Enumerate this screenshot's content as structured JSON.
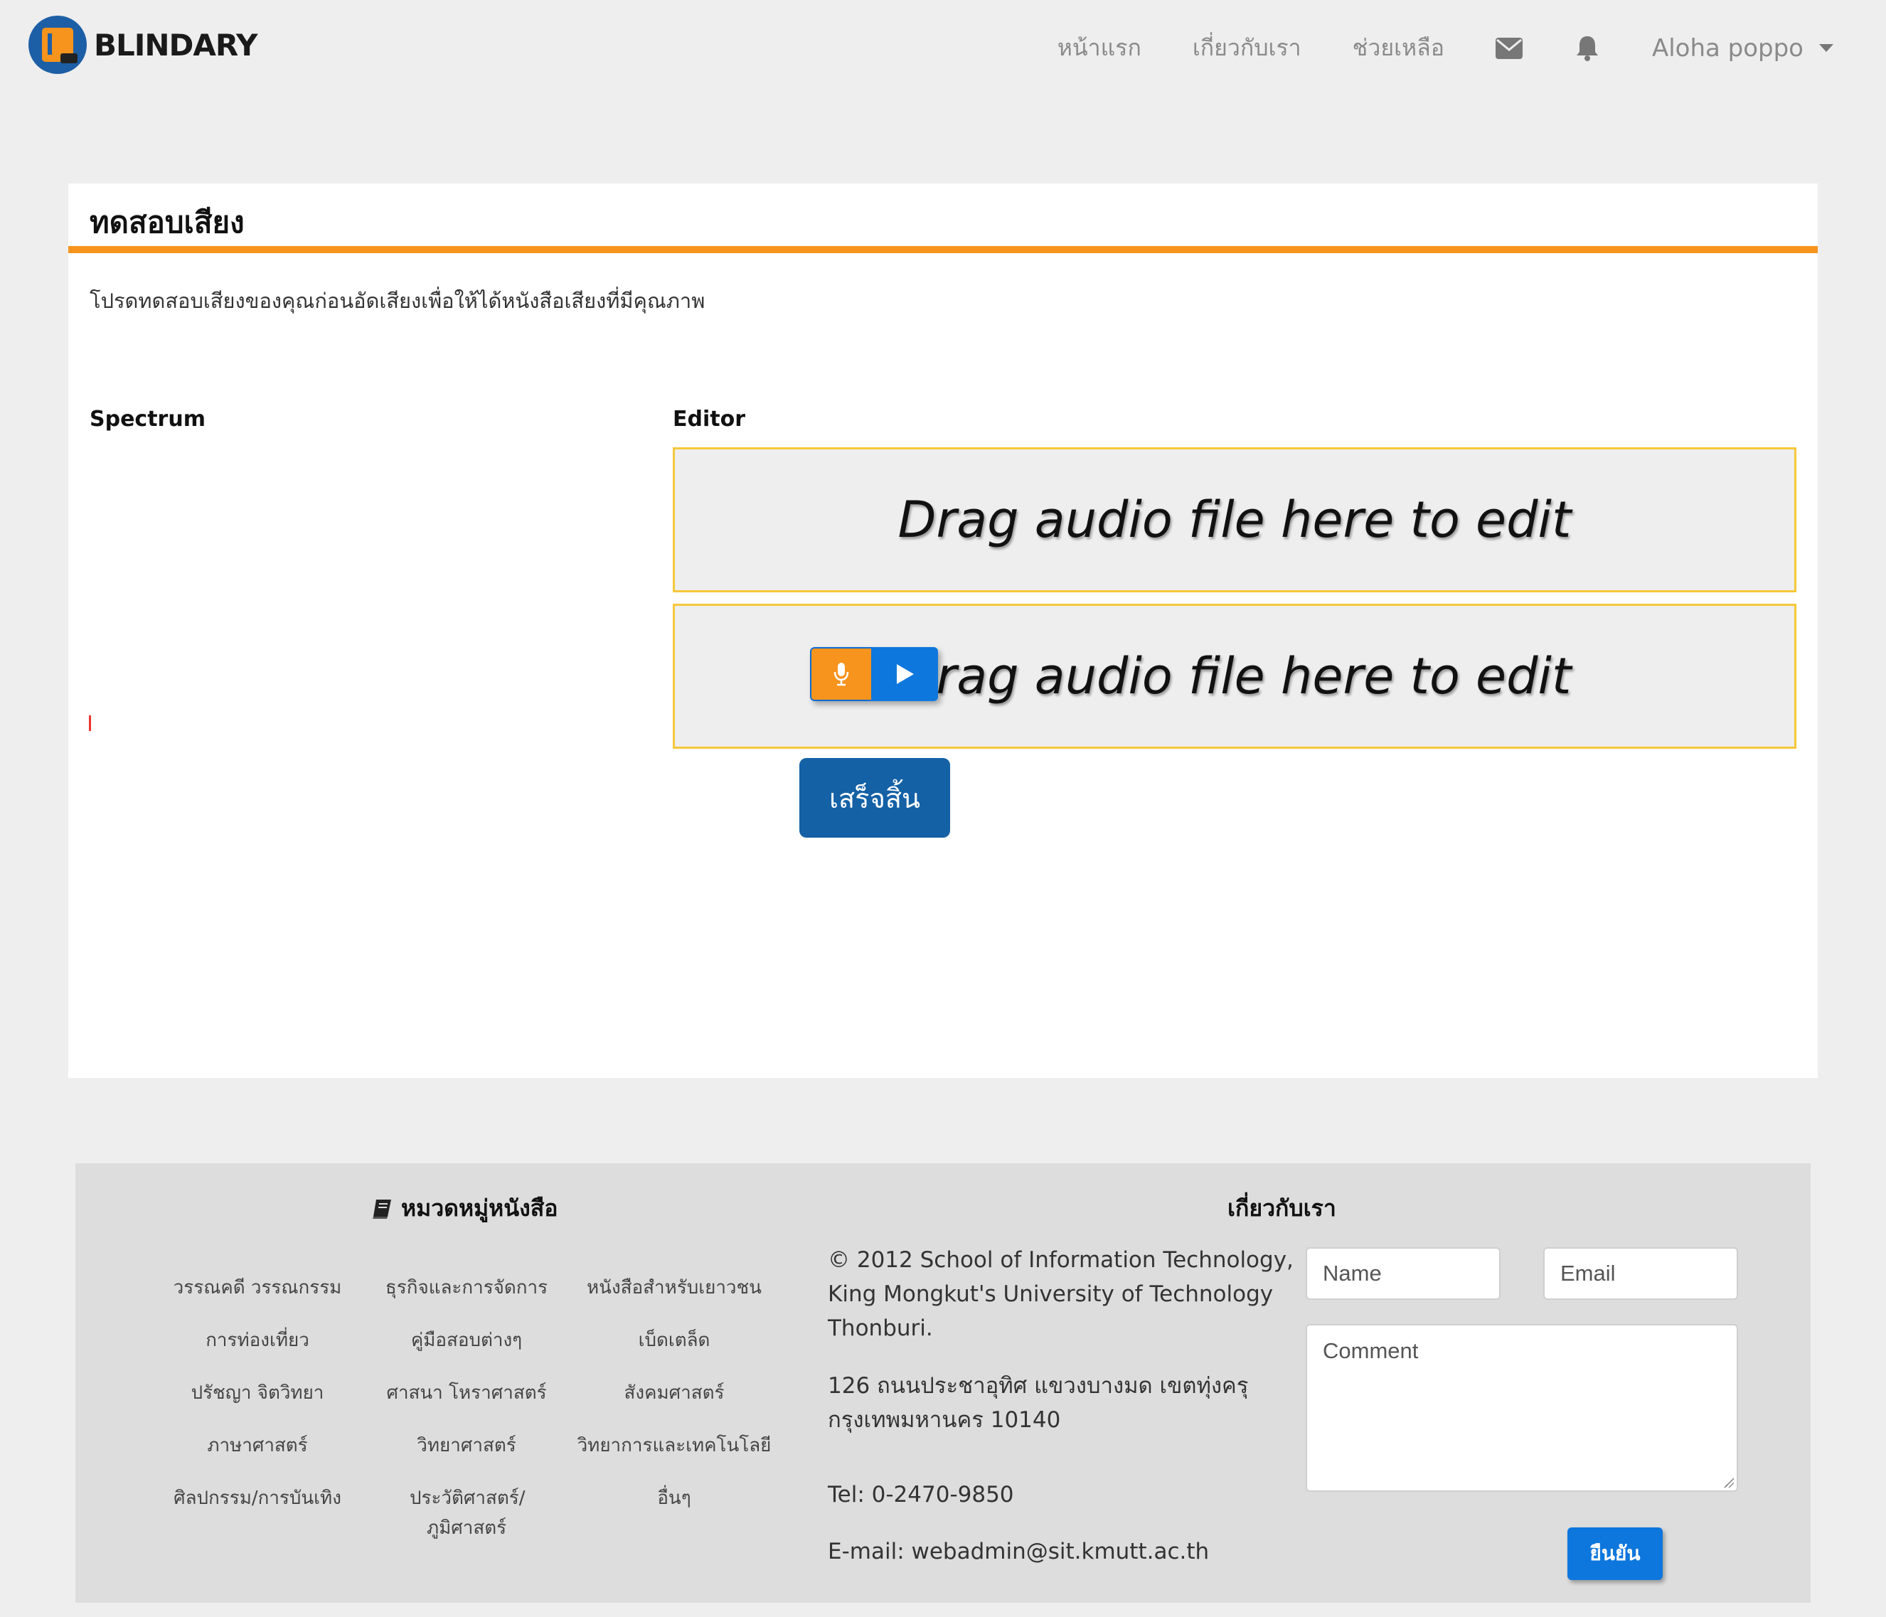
{
  "brand": {
    "name": "BLINDARY"
  },
  "nav": {
    "links": [
      "หน้าแรก",
      "เกี่ยวกับเรา",
      "ช่วยเหลือ"
    ],
    "user": "Aloha poppo",
    "icons": [
      "envelope-icon",
      "bell-icon"
    ]
  },
  "card": {
    "title": "ทดสอบเสียง",
    "description": "โปรดทดสอบเสียงของคุณก่อนอัดเสียงเพื่อให้ได้หนังสือเสียงที่มีคุณภาพ",
    "spectrum_label": "Spectrum",
    "editor_label": "Editor",
    "drop_zones": [
      "Drag audio file here to edit",
      "Drag audio file here to edit"
    ],
    "finish_label": "เสร็จสิ้น"
  },
  "footer": {
    "categories_title": "หมวดหมู่หนังสือ",
    "categories": [
      [
        "วรรณคดี วรรณกรรม",
        "การท่องเที่ยว",
        "ปรัชญา จิตวิทยา",
        "ภาษาศาสตร์",
        "ศิลปกรรม/การบันเทิง"
      ],
      [
        "ธุรกิจและการจัดการ",
        "คู่มือสอบต่างๆ",
        "ศาสนา โหราศาสตร์",
        "วิทยาศาสตร์",
        "ประวัติศาสตร์/ภูมิศาสตร์"
      ],
      [
        "หนังสือสำหรับเยาวชน",
        "เบ็ดเตล็ด",
        "สังคมศาสตร์",
        "วิทยาการและเทคโนโลยี",
        "อื่นๆ"
      ]
    ],
    "about_title": "เกี่ยวกับเรา",
    "copyright_lines": [
      "© 2012 School of Information Technology,",
      "King Mongkut's University of Technology",
      "Thonburi."
    ],
    "address_lines": [
      "126 ถนนประชาอุทิศ แขวงบางมด เขตทุ่งครุ",
      "กรุงเทพมหานคร 10140"
    ],
    "tel": "Tel: 0-2470-9850",
    "email": "E-mail: webadmin@sit.kmutt.ac.th",
    "form": {
      "name_placeholder": "Name",
      "email_placeholder": "Email",
      "comment_placeholder": "Comment",
      "submit_label": "ยืนยัน"
    }
  },
  "colors": {
    "accent": "#f7941d",
    "primary": "#0e77dd",
    "finish": "#1461a6",
    "dropzone_border": "#f5c83a"
  }
}
